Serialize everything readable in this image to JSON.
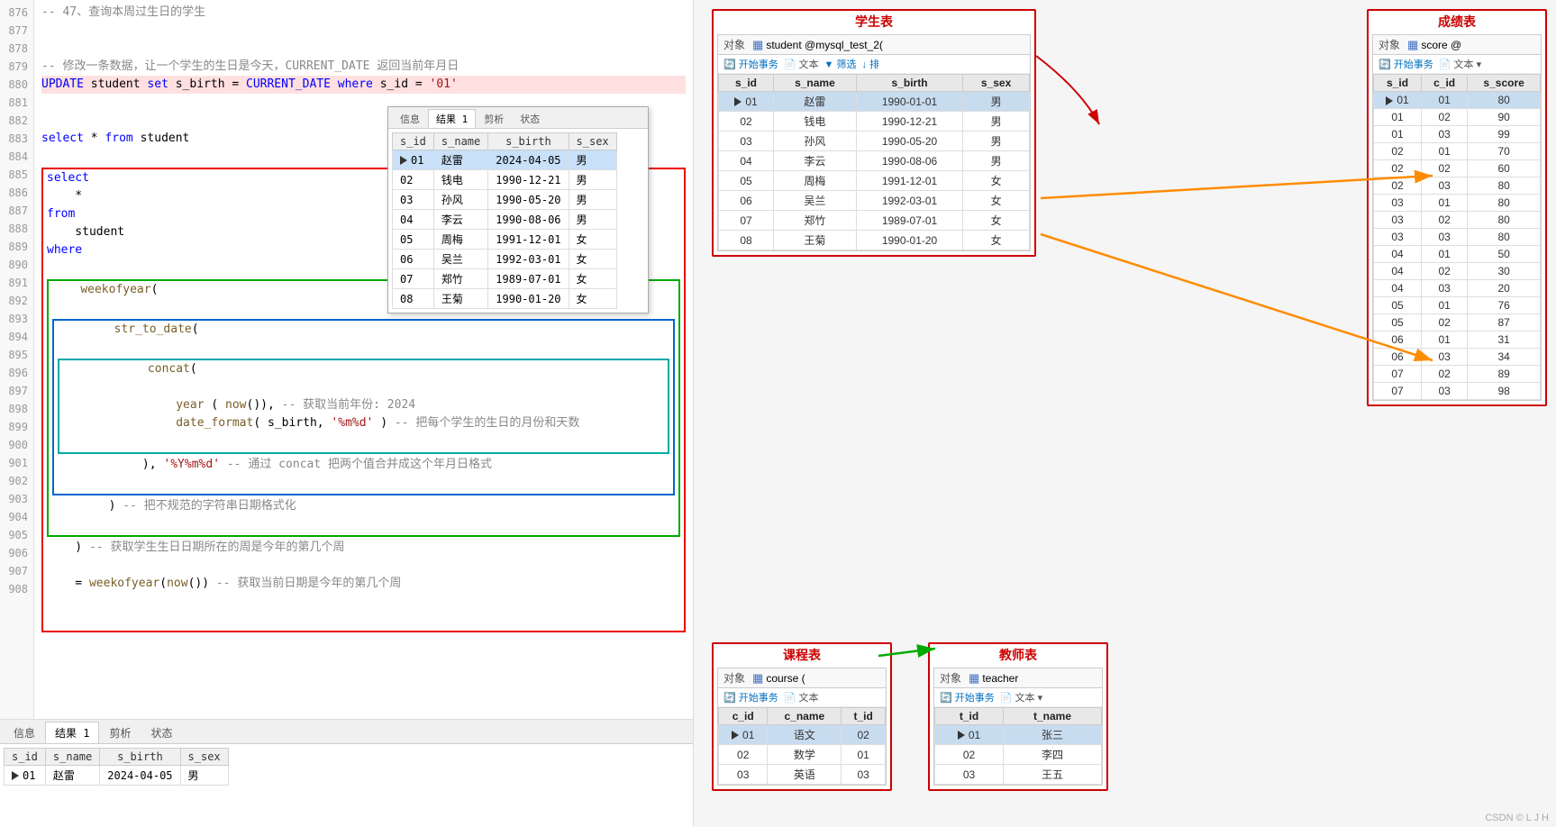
{
  "colors": {
    "keyword_blue": "#0000ff",
    "comment_gray": "#888888",
    "string_red": "#a31515",
    "function_brown": "#795e26",
    "border_red": "#cc0000",
    "highlight_blue": "#c8dcf0"
  },
  "tabs": {
    "info": "信息",
    "result1": "结果 1",
    "剪析": "剪析",
    "status": "状态"
  },
  "code_lines": [
    {
      "num": "877",
      "content": ""
    },
    {
      "num": "878",
      "content": ""
    },
    {
      "num": "879",
      "content": "-- 修改一条数据，让一个学生的生日是今天，CURRENT_DATE 返回当前年月日"
    },
    {
      "num": "880",
      "content": "UPDATE student set s_birth = CURRENT_DATE where s_id = '01'",
      "highlight": true
    },
    {
      "num": "881",
      "content": ""
    },
    {
      "num": "882",
      "content": ""
    },
    {
      "num": "883",
      "content": "select * from student"
    },
    {
      "num": "884",
      "content": ""
    },
    {
      "num": "885",
      "content": "select"
    },
    {
      "num": "886",
      "content": "    *"
    },
    {
      "num": "887",
      "content": "from"
    },
    {
      "num": "888",
      "content": "    student"
    },
    {
      "num": "889",
      "content": "where"
    },
    {
      "num": "890",
      "content": ""
    },
    {
      "num": "891",
      "content": "    weekofyear("
    },
    {
      "num": "892",
      "content": ""
    },
    {
      "num": "893",
      "content": "        str_to_date("
    },
    {
      "num": "894",
      "content": ""
    },
    {
      "num": "895",
      "content": "            concat("
    },
    {
      "num": "896",
      "content": ""
    },
    {
      "num": "897",
      "content": "                year ( now()), -- 获取当前年份: 2024"
    },
    {
      "num": "898",
      "content": "                date_format( s_birth, '%m%d' ) -- 把每个学生的生日的月份和天数"
    },
    {
      "num": "899",
      "content": ""
    },
    {
      "num": "900",
      "content": "            ), '%Y%m%d' -- 通过 concat 把两个值合并成这个年月日格式"
    },
    {
      "num": "901",
      "content": ""
    },
    {
      "num": "902",
      "content": "        ) -- 把不规范的字符串日期格式化"
    },
    {
      "num": "903",
      "content": ""
    },
    {
      "num": "904",
      "content": "    ) -- 获取学生生日日期所在的周是今年的第几个周"
    },
    {
      "num": "905",
      "content": ""
    },
    {
      "num": "906",
      "content": "    = weekofyear(now()) -- 获取当前日期是今年的第几个周"
    },
    {
      "num": "907",
      "content": ""
    },
    {
      "num": "908",
      "content": ""
    }
  ],
  "comment_line_47": "-- 47、查询本周过生日的学生",
  "line_876": "876",
  "popup_result": {
    "tabs": [
      "信息",
      "结果 1",
      "剪析",
      "状态"
    ],
    "columns": [
      "s_id",
      "s_name",
      "s_birth",
      "s_sex"
    ],
    "rows": [
      {
        "s_id": "01",
        "s_name": "赵雷",
        "s_birth": "2024-04-05",
        "s_sex": "男",
        "highlight": true
      },
      {
        "s_id": "02",
        "s_name": "钱电",
        "s_birth": "1990-12-21",
        "s_sex": "男"
      },
      {
        "s_id": "03",
        "s_name": "孙风",
        "s_birth": "1990-05-20",
        "s_sex": "男"
      },
      {
        "s_id": "04",
        "s_name": "李云",
        "s_birth": "1990-08-06",
        "s_sex": "男"
      },
      {
        "s_id": "05",
        "s_name": "周梅",
        "s_birth": "1991-12-01",
        "s_sex": "女"
      },
      {
        "s_id": "06",
        "s_name": "吴兰",
        "s_birth": "1992-03-01",
        "s_sex": "女"
      },
      {
        "s_id": "07",
        "s_name": "郑竹",
        "s_birth": "1989-07-01",
        "s_sex": "女"
      },
      {
        "s_id": "08",
        "s_name": "王菊",
        "s_birth": "1990-01-20",
        "s_sex": "女"
      }
    ]
  },
  "bottom_result": {
    "tabs": [
      "信息",
      "结果 1",
      "剪析",
      "状态"
    ],
    "columns": [
      "s_id",
      "s_name",
      "s_birth",
      "s_sex"
    ],
    "rows": [
      {
        "s_id": "01",
        "s_name": "赵雷",
        "s_birth": "2024-04-05",
        "s_sex": "男"
      }
    ]
  },
  "db_tables": {
    "student": {
      "title": "学生表",
      "header": "student @mysql_test_2(",
      "toolbar": [
        "开始事务",
        "文本",
        "筛选",
        "排"
      ],
      "columns": [
        "s_id",
        "s_name",
        "s_birth",
        "s_sex"
      ],
      "rows": [
        {
          "s_id": "01",
          "s_name": "赵雷",
          "s_birth": "1990-01-01",
          "s_sex": "男",
          "highlight": true
        },
        {
          "s_id": "02",
          "s_name": "钱电",
          "s_birth": "1990-12-21",
          "s_sex": "男"
        },
        {
          "s_id": "03",
          "s_name": "孙风",
          "s_birth": "1990-05-20",
          "s_sex": "男"
        },
        {
          "s_id": "04",
          "s_name": "李云",
          "s_birth": "1990-08-06",
          "s_sex": "男"
        },
        {
          "s_id": "05",
          "s_name": "周梅",
          "s_birth": "1991-12-01",
          "s_sex": "女"
        },
        {
          "s_id": "06",
          "s_name": "吴兰",
          "s_birth": "1992-03-01",
          "s_sex": "女"
        },
        {
          "s_id": "07",
          "s_name": "郑竹",
          "s_birth": "1989-07-01",
          "s_sex": "女"
        },
        {
          "s_id": "08",
          "s_name": "王菊",
          "s_birth": "1990-01-20",
          "s_sex": "女"
        }
      ]
    },
    "score": {
      "title": "成绩表",
      "header": "score @",
      "toolbar": [
        "开始事务",
        "文本"
      ],
      "columns": [
        "s_id",
        "c_id",
        "s_score"
      ],
      "rows": [
        {
          "s_id": "01",
          "c_id": "01",
          "s_score": "80",
          "highlight": true
        },
        {
          "s_id": "01",
          "c_id": "02",
          "s_score": "90"
        },
        {
          "s_id": "01",
          "c_id": "03",
          "s_score": "99"
        },
        {
          "s_id": "02",
          "c_id": "01",
          "s_score": "70"
        },
        {
          "s_id": "02",
          "c_id": "02",
          "s_score": "60"
        },
        {
          "s_id": "02",
          "c_id": "03",
          "s_score": "80"
        },
        {
          "s_id": "03",
          "c_id": "01",
          "s_score": "80"
        },
        {
          "s_id": "03",
          "c_id": "02",
          "s_score": "80"
        },
        {
          "s_id": "03",
          "c_id": "03",
          "s_score": "80"
        },
        {
          "s_id": "04",
          "c_id": "01",
          "s_score": "50"
        },
        {
          "s_id": "04",
          "c_id": "02",
          "s_score": "30"
        },
        {
          "s_id": "04",
          "c_id": "03",
          "s_score": "20"
        },
        {
          "s_id": "05",
          "c_id": "01",
          "s_score": "76"
        },
        {
          "s_id": "05",
          "c_id": "02",
          "s_score": "87"
        },
        {
          "s_id": "06",
          "c_id": "01",
          "s_score": "31"
        },
        {
          "s_id": "06",
          "c_id": "03",
          "s_score": "34"
        },
        {
          "s_id": "07",
          "c_id": "02",
          "s_score": "89"
        },
        {
          "s_id": "07",
          "c_id": "03",
          "s_score": "98"
        }
      ]
    },
    "course": {
      "title": "课程表",
      "header": "course (",
      "toolbar": [
        "开始事务",
        "文本"
      ],
      "columns": [
        "c_id",
        "c_name",
        "t_id"
      ],
      "rows": [
        {
          "c_id": "01",
          "c_name": "语文",
          "t_id": "02",
          "highlight": true
        },
        {
          "c_id": "02",
          "c_name": "数学",
          "t_id": "01"
        },
        {
          "c_id": "03",
          "c_name": "英语",
          "t_id": "03"
        }
      ]
    },
    "teacher": {
      "title": "教师表",
      "header": "teacher",
      "toolbar": [
        "开始事务",
        "文本"
      ],
      "columns": [
        "t_id",
        "t_name"
      ],
      "rows": [
        {
          "t_id": "01",
          "t_name": "张三",
          "highlight": true
        },
        {
          "t_id": "02",
          "t_name": "李四"
        },
        {
          "t_id": "03",
          "t_name": "王五"
        }
      ]
    }
  },
  "watermark": "CSDN © L J H"
}
